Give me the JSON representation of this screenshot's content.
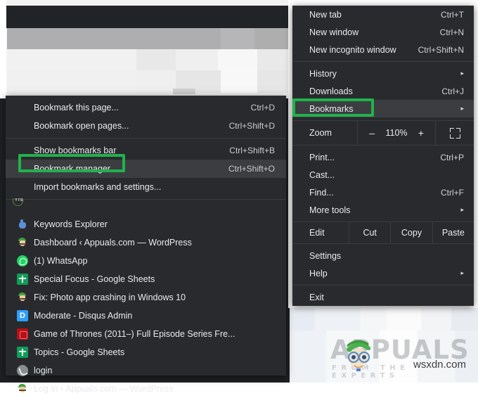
{
  "background": {
    "description": "blurred browser window behind menus"
  },
  "main_menu": {
    "name": "chrome-main-menu",
    "groups": [
      {
        "rows": [
          {
            "label": "New tab",
            "accel": "Ctrl+T",
            "arrow": "",
            "hovered": false
          },
          {
            "label": "New window",
            "accel": "Ctrl+N",
            "arrow": "",
            "hovered": false
          },
          {
            "label": "New incognito window",
            "accel": "Ctrl+Shift+N",
            "arrow": "",
            "hovered": false
          }
        ]
      },
      {
        "rows": [
          {
            "label": "History",
            "accel": "",
            "arrow": "▸",
            "hovered": false
          },
          {
            "label": "Downloads",
            "accel": "Ctrl+J",
            "arrow": "",
            "hovered": false
          },
          {
            "label": "Bookmarks",
            "accel": "",
            "arrow": "▸",
            "hovered": true
          }
        ]
      }
    ],
    "zoom_row": {
      "label": "Zoom",
      "minus": "–",
      "value": "110%",
      "plus": "+",
      "fullscreen_icon": "fullscreen-icon"
    },
    "tools_group": [
      {
        "label": "Print...",
        "accel": "Ctrl+P",
        "arrow": "",
        "hovered": false
      },
      {
        "label": "Cast...",
        "accel": "",
        "arrow": "",
        "hovered": false
      },
      {
        "label": "Find...",
        "accel": "Ctrl+F",
        "arrow": "",
        "hovered": false
      },
      {
        "label": "More tools",
        "accel": "",
        "arrow": "▸",
        "hovered": false
      }
    ],
    "edit_row": {
      "label": "Edit",
      "cut": "Cut",
      "copy": "Copy",
      "paste": "Paste"
    },
    "settings_group": [
      {
        "label": "Settings",
        "accel": "",
        "arrow": "",
        "hovered": false
      },
      {
        "label": "Help",
        "accel": "",
        "arrow": "▸",
        "hovered": false
      }
    ],
    "exit_group": [
      {
        "label": "Exit",
        "accel": "",
        "arrow": "",
        "hovered": false
      }
    ]
  },
  "bookmarks_submenu": {
    "name": "bookmarks-submenu",
    "group1": [
      {
        "label": "Bookmark this page...",
        "accel": "Ctrl+D",
        "hovered": false
      },
      {
        "label": "Bookmark open pages...",
        "accel": "Ctrl+Shift+D",
        "hovered": false
      }
    ],
    "group2": [
      {
        "label": "Show bookmarks bar",
        "accel": "Ctrl+Shift+B",
        "hovered": false
      },
      {
        "label": "Bookmark manager",
        "accel": "Ctrl+Shift+O",
        "hovered": true
      },
      {
        "label": "Import bookmarks and settings...",
        "accel": "",
        "hovered": false
      }
    ],
    "bookmarks": [
      {
        "label": "Keywords Explorer",
        "icon": "hand-pointer-icon"
      },
      {
        "label": "Dashboard ‹ Appuals.com — WordPress",
        "icon": "wordpress-icon"
      },
      {
        "label": "(1) WhatsApp",
        "icon": "whatsapp-icon"
      },
      {
        "label": "Special Focus - Google Sheets",
        "icon": "google-sheets-icon"
      },
      {
        "label": "Fix: Photo app crashing in Windows 10",
        "icon": "wordpress-icon"
      },
      {
        "label": "Moderate - Disqus Admin",
        "icon": "disqus-icon"
      },
      {
        "label": "Game of Thrones (2011–) Full Episode Series Fre...",
        "icon": "film-icon"
      },
      {
        "label": "Topics - Google Sheets",
        "icon": "google-sheets-icon"
      },
      {
        "label": "login",
        "icon": "generic-globe-icon"
      },
      {
        "label": "Log In ‹ Appuals.com — WordPress",
        "icon": "wordpress-icon"
      }
    ]
  },
  "highlights": {
    "color": "#22b14c",
    "boxes": [
      {
        "name": "bookmarks-highlight",
        "target": "Bookmarks"
      },
      {
        "name": "bookmark-manager-highlight",
        "target": "Bookmark manager"
      }
    ]
  },
  "watermark": {
    "word": "APPUALS",
    "subtitle": "FROM THE EXPERTS",
    "site": "wsxdn.com"
  },
  "colors": {
    "menu_bg": "#292a2d",
    "menu_hover": "#3c3d40",
    "menu_text": "#e8eaed",
    "separator": "#3b3c3f",
    "highlight_green": "#22b14c",
    "page_dark": "#1f2023"
  }
}
